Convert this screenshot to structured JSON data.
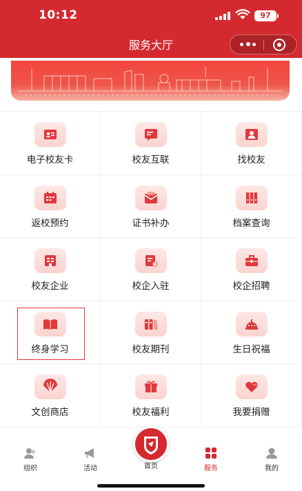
{
  "status": {
    "time": "10:12",
    "battery": "97"
  },
  "header": {
    "title": "服务大厅"
  },
  "capsule": {
    "more_icon": "more-dots-icon",
    "close_icon": "target-icon"
  },
  "grid": [
    {
      "label": "电子校友卡",
      "icon": "id-card-icon"
    },
    {
      "label": "校友互联",
      "icon": "chat-card-icon"
    },
    {
      "label": "找校友",
      "icon": "person-search-icon"
    },
    {
      "label": "返校预约",
      "icon": "calendar-icon"
    },
    {
      "label": "证书补办",
      "icon": "envelope-icon"
    },
    {
      "label": "档案查询",
      "icon": "binders-icon"
    },
    {
      "label": "校友企业",
      "icon": "building-icon"
    },
    {
      "label": "校企入驻",
      "icon": "add-document-icon"
    },
    {
      "label": "校企招聘",
      "icon": "briefcase-icon"
    },
    {
      "label": "终身学习",
      "icon": "open-book-icon"
    },
    {
      "label": "校友期刊",
      "icon": "books-icon"
    },
    {
      "label": "生日祝福",
      "icon": "cake-icon"
    },
    {
      "label": "文创商店",
      "icon": "fan-icon"
    },
    {
      "label": "校友福利",
      "icon": "gift-icon"
    },
    {
      "label": "我要捐赠",
      "icon": "heart-hand-icon"
    }
  ],
  "tabbar": [
    {
      "label": "组织",
      "icon": "people-icon"
    },
    {
      "label": "活动",
      "icon": "megaphone-icon"
    },
    {
      "label": "首页",
      "icon": "school-emblem-icon"
    },
    {
      "label": "服务",
      "icon": "grid-icon",
      "active": true
    },
    {
      "label": "我的",
      "icon": "user-icon"
    }
  ],
  "colors": {
    "brand": "#d42a2f",
    "icon_bg": "#fbd3cf",
    "selection": "#e2303a"
  }
}
